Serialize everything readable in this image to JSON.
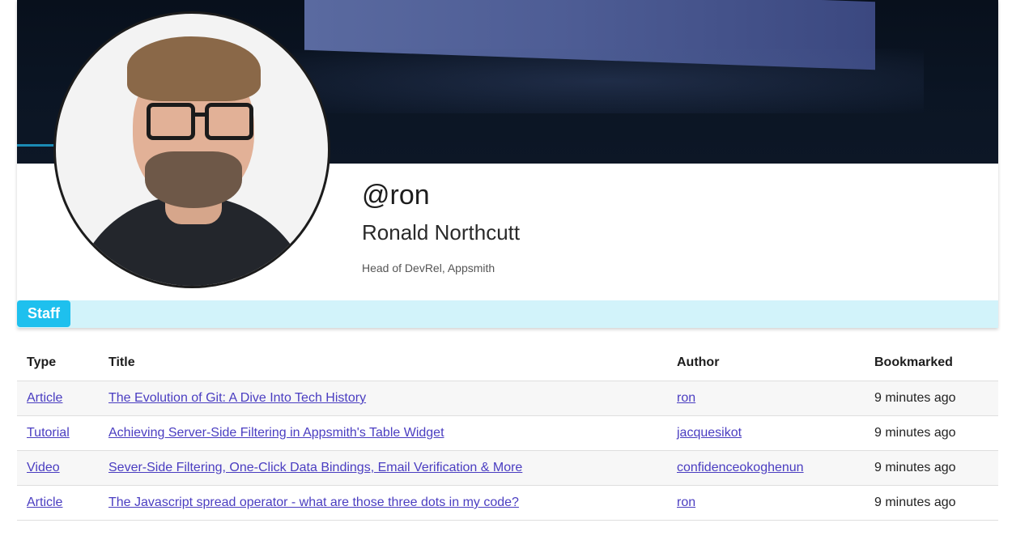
{
  "profile": {
    "username": "@ron",
    "full_name": "Ronald Northcutt",
    "bio": "Head of DevRel, Appsmith",
    "flair": "Staff"
  },
  "colors": {
    "flair_bg": "#1ec0ee",
    "flair_bar_bg": "#d2f3fa",
    "link": "#4a3dc1"
  },
  "table": {
    "headers": {
      "type": "Type",
      "title": "Title",
      "author": "Author",
      "bookmarked": "Bookmarked"
    },
    "rows": [
      {
        "type": "Article",
        "title": "The Evolution of Git: A Dive Into Tech History",
        "author": "ron",
        "bookmarked": "9 minutes ago"
      },
      {
        "type": "Tutorial",
        "title": "Achieving Server-Side Filtering in Appsmith's Table Widget",
        "author": "jacquesikot",
        "bookmarked": "9 minutes ago"
      },
      {
        "type": "Video",
        "title": "Sever-Side Filtering, One-Click Data Bindings, Email Verification & More",
        "author": "confidenceokoghenun",
        "bookmarked": "9 minutes ago"
      },
      {
        "type": "Article",
        "title": "The Javascript spread operator - what are those three dots in my code?",
        "author": "ron",
        "bookmarked": "9 minutes ago"
      }
    ]
  }
}
